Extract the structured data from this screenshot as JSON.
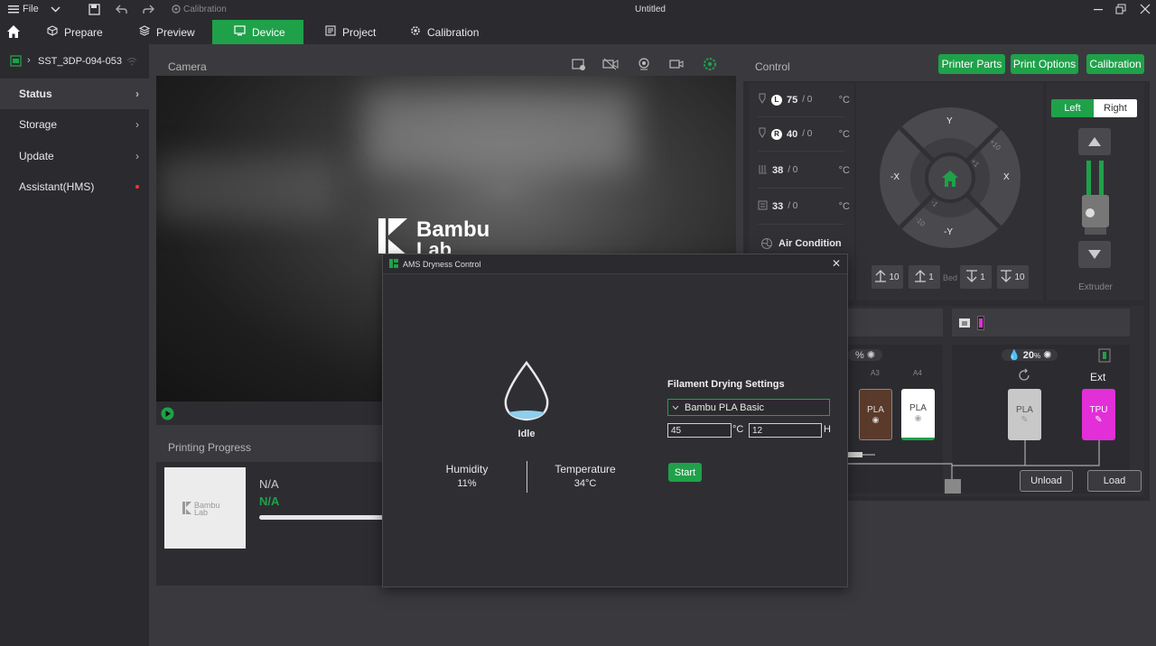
{
  "titlebar": {
    "file_label": "File",
    "calibration_label": "Calibration",
    "doc_title": "Untitled"
  },
  "tabs": [
    {
      "label": "Prepare"
    },
    {
      "label": "Preview"
    },
    {
      "label": "Device"
    },
    {
      "label": "Project"
    },
    {
      "label": "Calibration"
    }
  ],
  "sidebar": {
    "device_name": "SST_3DP-094-053",
    "items": [
      {
        "label": "Status"
      },
      {
        "label": "Storage"
      },
      {
        "label": "Update"
      },
      {
        "label": "Assistant(HMS)"
      }
    ]
  },
  "camera": {
    "title": "Camera",
    "logo_line1": "Bambu",
    "logo_line2": "Lab"
  },
  "progress": {
    "title": "Printing Progress",
    "name": "N/A",
    "status": "N/A",
    "thumb_text_1": "Bambu",
    "thumb_text_2": "Lab"
  },
  "control": {
    "title": "Control",
    "buttons": [
      "Printer Parts",
      "Print Options",
      "Calibration"
    ],
    "temps": [
      {
        "value": "75",
        "target": "/ 0",
        "unit": "°C",
        "badge": "L"
      },
      {
        "value": "40",
        "target": "/ 0",
        "unit": "°C",
        "badge": "R"
      },
      {
        "value": "38",
        "target": "/ 0",
        "unit": "°C"
      },
      {
        "value": "33",
        "target": "/ 0",
        "unit": "°C"
      }
    ],
    "air_condition": "Air Condition",
    "jog": {
      "y": "Y",
      "neg_y": "-Y",
      "x": "X",
      "neg_x": "-X",
      "p10": "+10",
      "p1": "+1",
      "m1": "-1",
      "m10": "-10"
    },
    "bed_buttons": [
      "10",
      "1",
      "1",
      "10"
    ],
    "bed_label": "Bed",
    "extruder": {
      "left": "Left",
      "right": "Right",
      "label": "Extruder"
    }
  },
  "ams": {
    "humidity_left": "%",
    "humidity_right": "20",
    "humidity_pct": "%",
    "slot_a3": "A3",
    "slot_a4": "A4",
    "spools": [
      {
        "label": "PLA",
        "color": "#5a3a2a"
      },
      {
        "label": "PLA",
        "color": "#ffffff"
      },
      {
        "label": "PLA",
        "color": "#c8c8c8"
      },
      {
        "label": "TPU",
        "color": "#e22fd8"
      }
    ],
    "ext_label": "Ext",
    "unload": "Unload",
    "load": "Load"
  },
  "modal": {
    "title": "AMS Dryness Control",
    "state": "Idle",
    "humidity_label": "Humidity",
    "humidity_value": "11%",
    "temperature_label": "Temperature",
    "temperature_value": "34°C",
    "settings_title": "Filament Drying Settings",
    "filament": "Bambu PLA Basic",
    "temp_input": "45",
    "temp_unit": "°C",
    "time_input": "12",
    "time_unit": "H",
    "start": "Start",
    "close": "✕"
  },
  "colors": {
    "accent": "#1fa14a",
    "bg": "#3a3a3e",
    "panel": "#2d2d31"
  }
}
